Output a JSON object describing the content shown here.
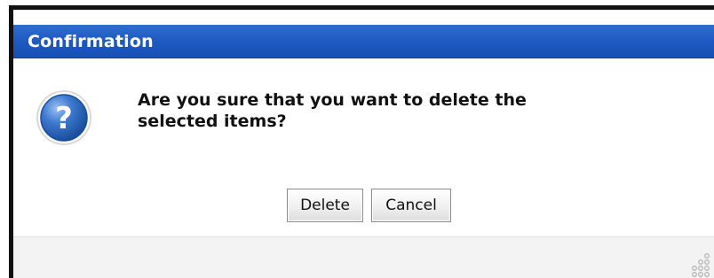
{
  "dialog": {
    "title": "Confirmation",
    "message": "Are you sure that you want to delete the\nselected items?",
    "icon": "question-icon",
    "buttons": {
      "delete_label": "Delete",
      "cancel_label": "Cancel"
    },
    "footer": {
      "grip_icon": "resize-grip-icon"
    }
  },
  "colors": {
    "title_bar": "#1f5bc3",
    "title_text": "#ffffff",
    "icon_fill": "#2b62b8",
    "footer_bg": "#f3f3f3"
  }
}
